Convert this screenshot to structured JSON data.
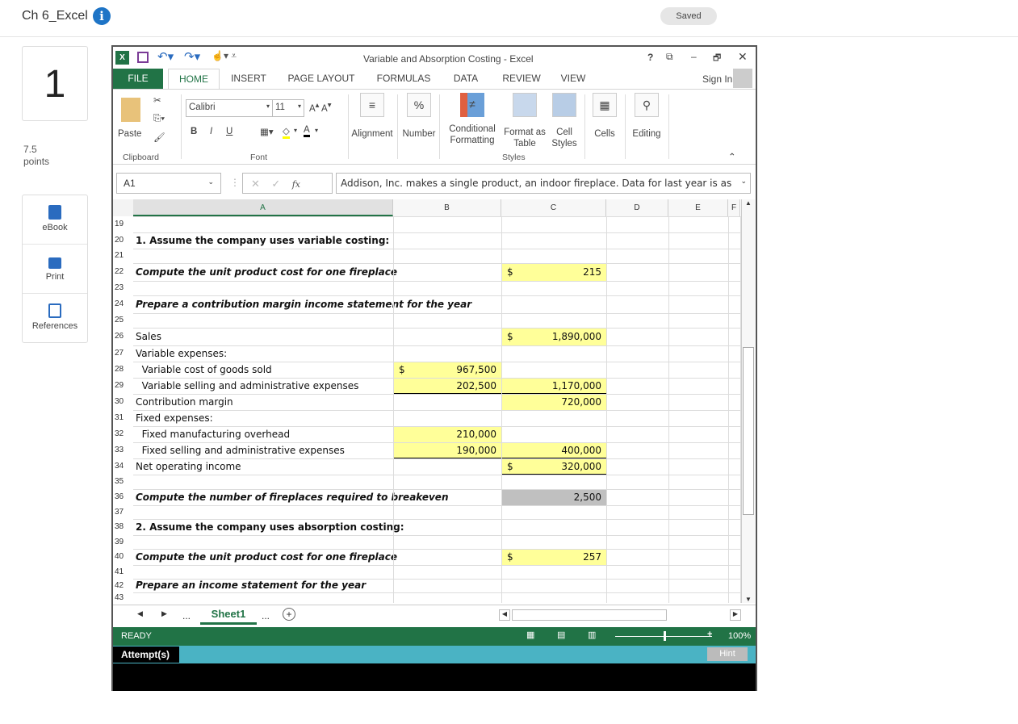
{
  "page": {
    "title": "Ch 6_Excel",
    "saved": "Saved",
    "question_number": "1",
    "points_value": "7.5",
    "points_label": "points",
    "tools": [
      {
        "label": "eBook",
        "icon": "book-icon"
      },
      {
        "label": "Print",
        "icon": "printer-icon"
      },
      {
        "label": "References",
        "icon": "copy-icon"
      }
    ]
  },
  "excel": {
    "window_title": "Variable and Absorption Costing - Excel",
    "window_controls": [
      "?",
      "⧉",
      "–",
      "🗗",
      "✕"
    ],
    "tabs": [
      "FILE",
      "HOME",
      "INSERT",
      "PAGE LAYOUT",
      "FORMULAS",
      "DATA",
      "REVIEW",
      "VIEW"
    ],
    "active_tab": "HOME",
    "sign_in": "Sign In",
    "ribbon": {
      "paste": "Paste",
      "clipboard": "Clipboard",
      "font_name": "Calibri",
      "font_size": "11",
      "font": "Font",
      "bold": "B",
      "italic": "I",
      "underline": "U",
      "alignment": "Alignment",
      "number": "Number",
      "conditional_formatting": "Conditional Formatting",
      "format_as_table": "Format as Table",
      "cell_styles": "Cell Styles",
      "styles": "Styles",
      "cells": "Cells",
      "editing": "Editing"
    },
    "name_box": "A1",
    "fx": "fx",
    "formula": "Addison, Inc. makes a single product, an indoor fireplace. Data for last year is as",
    "columns": [
      "A",
      "B",
      "C",
      "D",
      "E",
      "F"
    ],
    "rows": [
      {
        "n": "19"
      },
      {
        "n": "20",
        "a": "1. Assume the company uses variable costing:",
        "style": "bold"
      },
      {
        "n": "21"
      },
      {
        "n": "22",
        "a": "Compute the unit product cost for one fireplace",
        "style": "bi",
        "c_sym": "$",
        "c": "215",
        "c_fill": "yellow"
      },
      {
        "n": "23"
      },
      {
        "n": "24",
        "a": "Prepare a contribution margin income statement for the year",
        "style": "bi"
      },
      {
        "n": "25"
      },
      {
        "n": "26",
        "a": "Sales",
        "c_sym": "$",
        "c": "1,890,000",
        "c_fill": "yellow"
      },
      {
        "n": "27",
        "a": "Variable expenses:"
      },
      {
        "n": "28",
        "a": "  Variable cost of goods sold",
        "b_sym": "$",
        "b": "967,500",
        "b_fill": "yellow"
      },
      {
        "n": "29",
        "a": "  Variable selling and administrative expenses",
        "b": "202,500",
        "b_fill": "yellow",
        "b_ul": true,
        "c": "1,170,000",
        "c_fill": "yellow",
        "c_ul": true
      },
      {
        "n": "30",
        "a": "Contribution margin",
        "c": "720,000",
        "c_fill": "yellow"
      },
      {
        "n": "31",
        "a": "Fixed expenses:"
      },
      {
        "n": "32",
        "a": "  Fixed manufacturing overhead",
        "b": "210,000",
        "b_fill": "yellow"
      },
      {
        "n": "33",
        "a": "  Fixed selling and administrative expenses",
        "b": "190,000",
        "b_fill": "yellow",
        "b_ul": true,
        "c": "400,000",
        "c_fill": "yellow",
        "c_ul": true
      },
      {
        "n": "34",
        "a": "Net operating income",
        "c_sym": "$",
        "c": "320,000",
        "c_fill": "yellow",
        "c_ul": true
      },
      {
        "n": "35"
      },
      {
        "n": "36",
        "a": "Compute the number of fireplaces required to breakeven",
        "style": "bi",
        "c": "2,500",
        "c_fill": "gray"
      },
      {
        "n": "37"
      },
      {
        "n": "38",
        "a": "2. Assume the company uses absorption costing:",
        "style": "bold"
      },
      {
        "n": "39"
      },
      {
        "n": "40",
        "a": "Compute the unit product cost for one fireplace",
        "style": "bi",
        "c_sym": "$",
        "c": "257",
        "c_fill": "yellow"
      },
      {
        "n": "41"
      },
      {
        "n": "42",
        "a": "Prepare an income statement for the year",
        "style": "bi"
      },
      {
        "n": "43"
      }
    ],
    "sheet_tab": "Sheet1",
    "ellipsis": "...",
    "add_sheet": "+",
    "status": "READY",
    "zoom": "100%",
    "zoom_level_percent": 100,
    "attempts": "Attempt(s)",
    "hint": "Hint",
    "colors": {
      "excel_green": "#217346",
      "attempt_bar": "#4ab3c4",
      "input_fill": "#ffff99",
      "answer_fill": "#c0c0c0"
    }
  }
}
